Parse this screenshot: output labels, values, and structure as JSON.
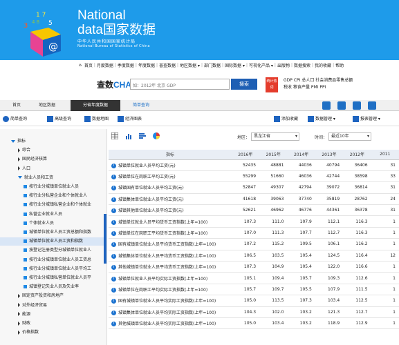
{
  "brand": {
    "line1": "National",
    "line2": "data国家数据",
    "line3": "中华人民共和国国家统计局",
    "line4": "National Bureau of Statistics of China"
  },
  "nav": [
    "首页",
    "月度数据",
    "季度数据",
    "年度数据",
    "普查数据",
    "地区数据 ▾",
    "部门数据",
    "国际数据 ▾",
    "可视化产品 ▾",
    "出版物",
    "数据搜索",
    "我的收藏",
    "帮助"
  ],
  "search": {
    "logo_a": "查数",
    "logo_b": "CHASHU",
    "placeholder": "如：2012年 北京 GDP",
    "button": "搜索",
    "hot_label": "统计热词",
    "hot_words": [
      "GDP",
      "CPI",
      "总人口",
      "社会消费品零售总额",
      "税收",
      "粮食产量",
      "PMI",
      "PPI"
    ]
  },
  "tabs": {
    "home": "首页",
    "region": "地区数据",
    "active": "分省年度数据",
    "simple": "简单查询"
  },
  "toolbar": {
    "simple": "简单查询",
    "advanced": "高级查询",
    "map": "数据地图",
    "chart": "经济图表",
    "add_fav": "添加收藏",
    "data_mgmt": "数据管理 ▾",
    "report_mgmt": "报表管理 ▾"
  },
  "region_bar": {
    "region_label": "地区：",
    "region_value": "黑龙江省",
    "time_label": "时间：",
    "time_value": "最近10年"
  },
  "sidebar": [
    {
      "label": "指标",
      "level": 0,
      "open": true
    },
    {
      "label": "综合",
      "level": 1
    },
    {
      "label": "国民经济核算",
      "level": 1
    },
    {
      "label": "人口",
      "level": 1
    },
    {
      "label": "就业人员和工资",
      "level": 1,
      "open": true
    },
    {
      "label": "按行业分城镇单位就业人员",
      "level": 2
    },
    {
      "label": "按行业分私营企业和个体就业人",
      "level": 2
    },
    {
      "label": "按行业分城镇私营企业和个体就业",
      "level": 2
    },
    {
      "label": "私营企业就业人员",
      "level": 2
    },
    {
      "label": "个体就业人员",
      "level": 2
    },
    {
      "label": "城镇单位就业人员工资总额和指数",
      "level": 2
    },
    {
      "label": "城镇单位就业人员工资和指数",
      "level": 2,
      "selected": true
    },
    {
      "label": "按登记注册类型分城镇单位就业人",
      "level": 2
    },
    {
      "label": "按行业分城镇单位就业人员工资总",
      "level": 2
    },
    {
      "label": "按行业分城镇单位就业人员平均工",
      "level": 2
    },
    {
      "label": "按行业分城镇私营单位就业人员平",
      "level": 2
    },
    {
      "label": "城镇登记失业人员及失业率",
      "level": 2
    },
    {
      "label": "固定资产投资和房地产",
      "level": 1
    },
    {
      "label": "对外经济贸易",
      "level": 1
    },
    {
      "label": "能源",
      "level": 1
    },
    {
      "label": "财政",
      "level": 1
    },
    {
      "label": "价格指数",
      "level": 1
    }
  ],
  "table": {
    "header_indicator": "指标",
    "years": [
      "2016年",
      "2015年",
      "2014年",
      "2013年",
      "2012年",
      "2011"
    ],
    "rows": [
      {
        "name": "城镇单位就业人员平均工资(元)",
        "values": [
          "52435",
          "48881",
          "44036",
          "40794",
          "36406",
          "31"
        ]
      },
      {
        "name": "城镇单位在岗职工平均工资(元)",
        "values": [
          "55299",
          "51660",
          "46036",
          "42744",
          "38598",
          "33"
        ]
      },
      {
        "name": "城镇国有单位就业人员平均工资(元)",
        "values": [
          "52847",
          "49307",
          "42794",
          "39072",
          "36814",
          "31"
        ]
      },
      {
        "name": "城镇集体单位就业人员平均工资(元)",
        "values": [
          "41618",
          "39063",
          "37740",
          "35819",
          "28762",
          "24"
        ]
      },
      {
        "name": "城镇其他单位就业人员平均工资(元)",
        "values": [
          "52621",
          "46962",
          "46776",
          "44361",
          "36378",
          "31"
        ]
      },
      {
        "name": "城镇单位就业人员平均货币工资指数(上年=100)",
        "values": [
          "107.3",
          "111.0",
          "107.9",
          "112.1",
          "116.3",
          "1"
        ]
      },
      {
        "name": "城镇单位在岗职工平均货币工资指数(上年=100)",
        "values": [
          "107.0",
          "111.3",
          "107.7",
          "112.7",
          "116.3",
          "1"
        ]
      },
      {
        "name": "国有城镇单位就业人员平均货币工资指数(上年=100)",
        "values": [
          "107.2",
          "115.2",
          "109.5",
          "106.1",
          "116.2",
          "1"
        ]
      },
      {
        "name": "城镇集体单位就业人员平均货币工资指数(上年=100)",
        "values": [
          "106.5",
          "103.5",
          "105.4",
          "124.5",
          "116.4",
          "12"
        ]
      },
      {
        "name": "其他城镇单位就业人员平均货币工资指数(上年=100)",
        "values": [
          "107.3",
          "104.9",
          "105.4",
          "122.0",
          "116.6",
          "1"
        ]
      },
      {
        "name": "城镇单位就业人员平均实际工资指数(上年=100)",
        "values": [
          "105.1",
          "109.4",
          "105.7",
          "109.3",
          "112.6",
          "1"
        ]
      },
      {
        "name": "城镇单位在岗职工平均实际工资指数(上年=100)",
        "values": [
          "105.7",
          "109.7",
          "105.5",
          "107.9",
          "111.5",
          "1"
        ]
      },
      {
        "name": "国有城镇单位就业人员平均实际工资指数(上年=100)",
        "values": [
          "105.0",
          "113.5",
          "107.3",
          "103.4",
          "112.5",
          "1"
        ]
      },
      {
        "name": "城镇集体单位就业人员平均实际工资指数(上年=100)",
        "values": [
          "104.3",
          "102.0",
          "103.2",
          "121.3",
          "112.7",
          "1"
        ]
      },
      {
        "name": "其他城镇单位就业人员平均实际工资指数(上年=100)",
        "values": [
          "105.0",
          "103.4",
          "103.2",
          "118.9",
          "112.9",
          "1"
        ]
      }
    ]
  },
  "colors": {
    "banner": "#1e9bea",
    "accent": "#1e64c0",
    "hot": "#e43c2c"
  }
}
